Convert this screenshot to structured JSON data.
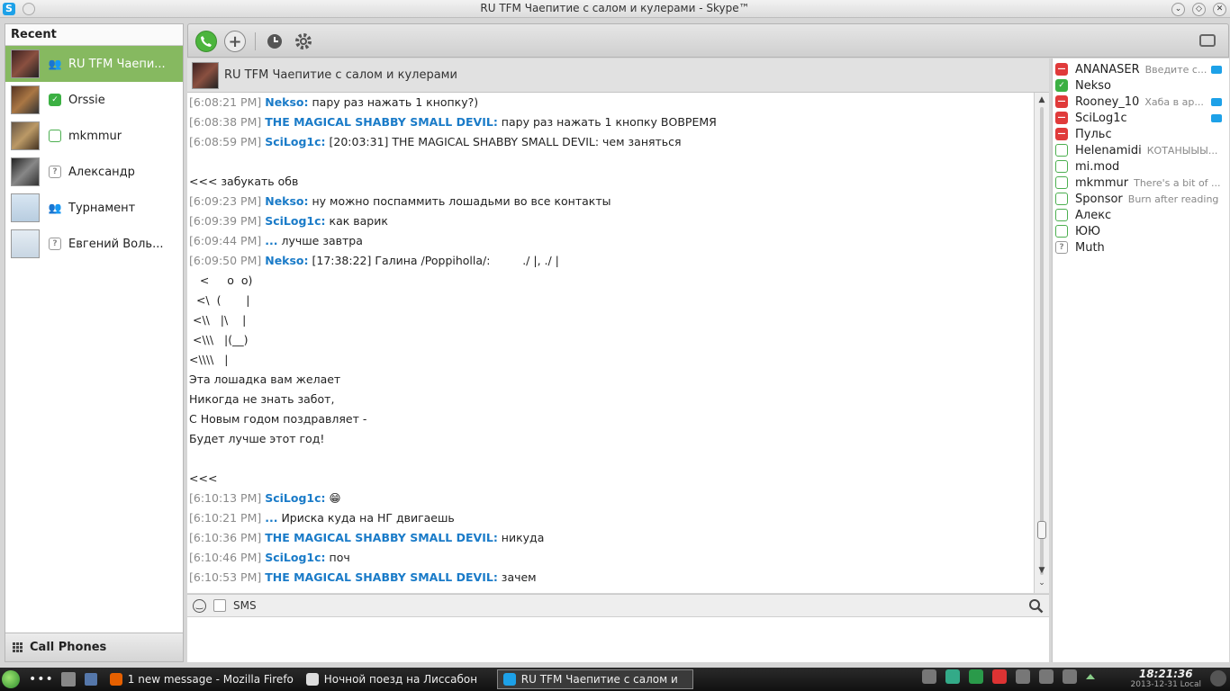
{
  "window": {
    "title": "RU TFM Чаепитие с салом и кулерами - Skype™"
  },
  "recent": {
    "header": "Recent",
    "items": [
      {
        "name": "RU TFM Чаепи...",
        "status": "group"
      },
      {
        "name": "Orssie",
        "status": "online"
      },
      {
        "name": "mkmmur",
        "status": "offline"
      },
      {
        "name": "Александр",
        "status": "unknown"
      },
      {
        "name": "Турнамент",
        "status": "group"
      },
      {
        "name": "Евгений Воль...",
        "status": "unknown"
      }
    ],
    "call_phones": "Call Phones"
  },
  "chat": {
    "title": "RU TFM Чаепитие с салом и кулерами",
    "sms_label": "SMS",
    "messages": [
      {
        "time": "[6:08:21 PM]",
        "author": "Nekso:",
        "text": " пару раз нажать 1 кнопку?)"
      },
      {
        "time": "[6:08:38 PM]",
        "author": "THE MAGICAL SHABBY SMALL DEVIL:",
        "text": " пару раз нажать 1 кнопку ВОВРЕМЯ"
      },
      {
        "time": "[6:08:59 PM]",
        "author": "SciLog1c:",
        "text": " [20:03:31] THE MAGICAL SHABBY SMALL DEVIL: чем заняться"
      },
      {
        "time": "",
        "author": "",
        "text": ""
      },
      {
        "time": "",
        "author": "",
        "text": "<<< забукать обв"
      },
      {
        "time": "[6:09:23 PM]",
        "author": "Nekso:",
        "text": " ну можно поспаммить лошадьми во все контакты"
      },
      {
        "time": "[6:09:39 PM]",
        "author": "SciLog1c:",
        "text": " как варик"
      },
      {
        "time": "[6:09:44 PM]",
        "author": "...",
        "text": " лучше завтра"
      },
      {
        "time": "[6:09:50 PM]",
        "author": "Nekso:",
        "text": " [17:38:22] Галина /Poppiholla/:         ./ |, ./ |"
      },
      {
        "time": "",
        "author": "",
        "text": "   <     o  o)"
      },
      {
        "time": "",
        "author": "",
        "text": "  <\\  (       |"
      },
      {
        "time": "",
        "author": "",
        "text": " <\\\\   |\\    |"
      },
      {
        "time": "",
        "author": "",
        "text": " <\\\\\\   |(__)"
      },
      {
        "time": "",
        "author": "",
        "text": "<\\\\\\\\   |"
      },
      {
        "time": "",
        "author": "",
        "text": "Эта лошадка вам желает"
      },
      {
        "time": "",
        "author": "",
        "text": "Никогда не знать забот,"
      },
      {
        "time": "",
        "author": "",
        "text": "С Новым годом поздравляет -"
      },
      {
        "time": "",
        "author": "",
        "text": "Будет лучше этот год!"
      },
      {
        "time": "",
        "author": "",
        "text": ""
      },
      {
        "time": "",
        "author": "",
        "text": "<<<"
      },
      {
        "time": "[6:10:13 PM]",
        "author": "SciLog1c:",
        "text": " 😁"
      },
      {
        "time": "[6:10:21 PM]",
        "author": "...",
        "text": " Ириска куда на НГ двигаешь"
      },
      {
        "time": "[6:10:36 PM]",
        "author": "THE MAGICAL SHABBY SMALL DEVIL:",
        "text": " никуда"
      },
      {
        "time": "[6:10:46 PM]",
        "author": "SciLog1c:",
        "text": " поч"
      },
      {
        "time": "[6:10:53 PM]",
        "author": "THE MAGICAL SHABBY SMALL DEVIL:",
        "text": " зачем"
      }
    ]
  },
  "participants": [
    {
      "name": "ANANASER",
      "mood": "Введите с...",
      "status": "dnd",
      "video": true
    },
    {
      "name": "Nekso",
      "mood": "",
      "status": "online",
      "video": false
    },
    {
      "name": "Rooney_10",
      "mood": "Хаба в ар...",
      "status": "dnd",
      "video": true
    },
    {
      "name": "SciLog1c",
      "mood": "",
      "status": "dnd",
      "video": true
    },
    {
      "name": "Пульс",
      "mood": "",
      "status": "dnd",
      "video": false
    },
    {
      "name": "Helenamidi",
      "mood": "КОТАНЫЫЫ...",
      "status": "offline",
      "video": false
    },
    {
      "name": "mi.mod",
      "mood": "",
      "status": "offline",
      "video": false
    },
    {
      "name": "mkmmur",
      "mood": "There's a bit of ...",
      "status": "offline",
      "video": false
    },
    {
      "name": "Sponsor",
      "mood": "Burn after reading",
      "status": "offline",
      "video": false
    },
    {
      "name": "Алекс",
      "mood": "",
      "status": "offline",
      "video": false
    },
    {
      "name": "ЮЮ",
      "mood": "",
      "status": "offline",
      "video": false
    },
    {
      "name": "Muth",
      "mood": "",
      "status": "unknown",
      "video": false
    }
  ],
  "taskbar": {
    "tasks": [
      {
        "label": "1 new message - Mozilla Firefo",
        "icon": "firefox-icon",
        "color": "#e66000"
      },
      {
        "label": "Ночной поезд на Лиссабон",
        "icon": "document-icon",
        "color": "#dddddd"
      },
      {
        "label": "RU TFM Чаепитие с салом и",
        "icon": "skype-icon",
        "color": "#1da1e8"
      }
    ],
    "clock_time": "18:21:36",
    "clock_date": "2013-12-31 Local"
  },
  "colors": {
    "accent": "#86b960",
    "author": "#1a7bc8",
    "skype": "#1da1e8"
  }
}
